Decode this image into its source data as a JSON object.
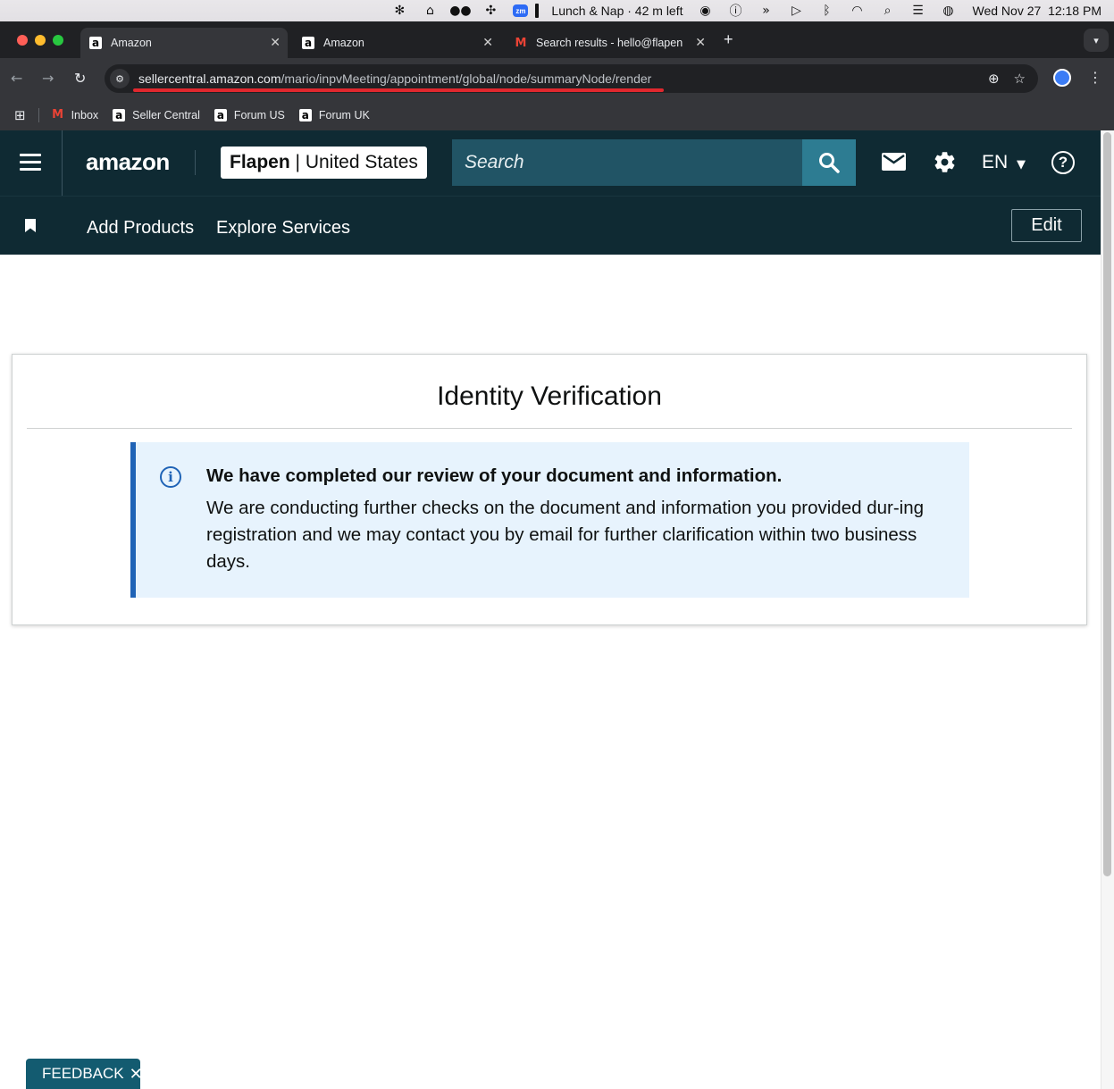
{
  "menubar": {
    "focus_text": "Lunch & Nap · 42 m left",
    "clock_date": "Wed Nov 27",
    "clock_time": "12:18 PM",
    "zoom_label": "zm"
  },
  "tabs": [
    {
      "label": "Amazon",
      "favicon": "a"
    },
    {
      "label": "Amazon",
      "favicon": "a"
    },
    {
      "label": "Search results - hello@flapen",
      "favicon": "M"
    }
  ],
  "address_bar": {
    "host": "sellercentral.amazon.com",
    "path": "/mario/inpvMeeting/appointment/global/node/summaryNode/render"
  },
  "bookmarks": [
    {
      "label": "Inbox",
      "favicon": "M"
    },
    {
      "label": "Seller Central",
      "favicon": "a"
    },
    {
      "label": "Forum US",
      "favicon": "a"
    },
    {
      "label": "Forum UK",
      "favicon": "a"
    }
  ],
  "header": {
    "logo_text": "amazon",
    "store_name": "Flapen",
    "store_separator": " | ",
    "store_region": "United States",
    "search_placeholder": "Search",
    "language": "EN"
  },
  "nav": {
    "links": [
      "Add Products",
      "Explore Services"
    ],
    "edit_label": "Edit"
  },
  "card": {
    "title": "Identity Verification",
    "alert_heading": "We have completed our review of your document and information.",
    "alert_body": "We are conducting further checks on the document and information you provided dur-ing registration and we may contact you by email for further clarification within two business days."
  },
  "feedback": {
    "label": "FEEDBACK"
  },
  "colors": {
    "header_bg": "#0f2a33",
    "search_bg": "#215465",
    "search_button": "#2d7c92",
    "alert_bg": "#e7f3fd",
    "alert_accent": "#1f63b6",
    "feedback_bg": "#135b70",
    "annotation_red": "#e0282e"
  },
  "icons": [
    "apple-menu-extras-icon",
    "search-icon",
    "mail-icon",
    "gear-icon",
    "help-icon",
    "info-icon",
    "close-icon",
    "bookmark-icon",
    "hamburger-icon"
  ]
}
